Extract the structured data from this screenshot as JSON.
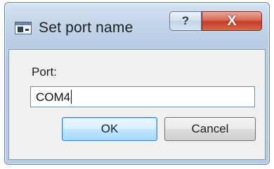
{
  "window": {
    "title": "Set port name",
    "help_button": "?",
    "close_button": "X"
  },
  "form": {
    "port_label": "Port:",
    "port_value": "COM4"
  },
  "buttons": {
    "ok_label": "OK",
    "cancel_label": "Cancel"
  },
  "icons": {
    "app": "window-app-icon",
    "help": "help-icon",
    "close": "close-icon"
  }
}
